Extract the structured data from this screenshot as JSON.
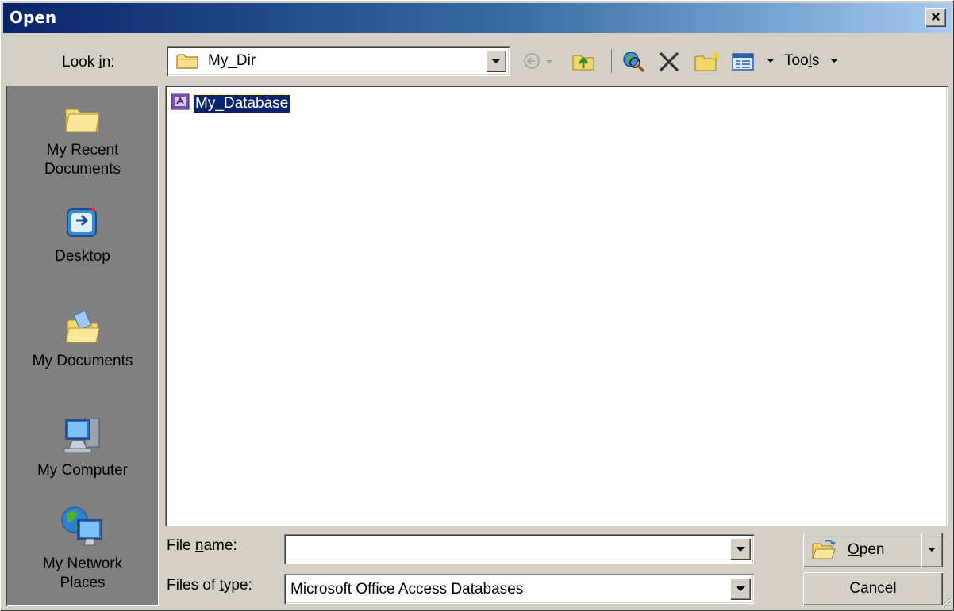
{
  "window": {
    "title": "Open",
    "close_glyph": "×"
  },
  "look_in": {
    "label_pre": "Look ",
    "label_ul": "i",
    "label_post": "n:",
    "value": "My_Dir",
    "icon": "folder-icon"
  },
  "toolbar": {
    "back_icon": "back-icon",
    "up_icon": "up-one-level-icon",
    "search_web_icon": "search-web-icon",
    "delete_icon": "delete-icon",
    "new_folder_icon": "new-folder-icon",
    "views_icon": "views-icon",
    "tools_pre": "Too",
    "tools_ul": "l",
    "tools_post": "s"
  },
  "places": [
    {
      "label1": "My Recent",
      "label2": "Documents",
      "icon": "recent-documents-icon"
    },
    {
      "label1": "Desktop",
      "label2": "",
      "icon": "desktop-icon"
    },
    {
      "label1": "My Documents",
      "label2": "",
      "icon": "my-documents-icon"
    },
    {
      "label1": "My Computer",
      "label2": "",
      "icon": "my-computer-icon"
    },
    {
      "label1": "My Network",
      "label2": "Places",
      "icon": "my-network-places-icon"
    }
  ],
  "files": [
    {
      "name": "My_Database",
      "icon": "access-database-icon",
      "selected": true
    }
  ],
  "file_name": {
    "label_pre": "File ",
    "label_ul": "n",
    "label_post": "ame:",
    "value": ""
  },
  "file_type": {
    "label_pre": "Files of ",
    "label_ul": "t",
    "label_post": "ype:",
    "value": "Microsoft Office Access Databases"
  },
  "buttons": {
    "open_ul": "O",
    "open_post": "pen",
    "cancel": "Cancel"
  },
  "colors": {
    "title_start": "#0a246a",
    "title_end": "#a6caf0",
    "face": "#d4d0c8",
    "selection": "#0a246a"
  }
}
